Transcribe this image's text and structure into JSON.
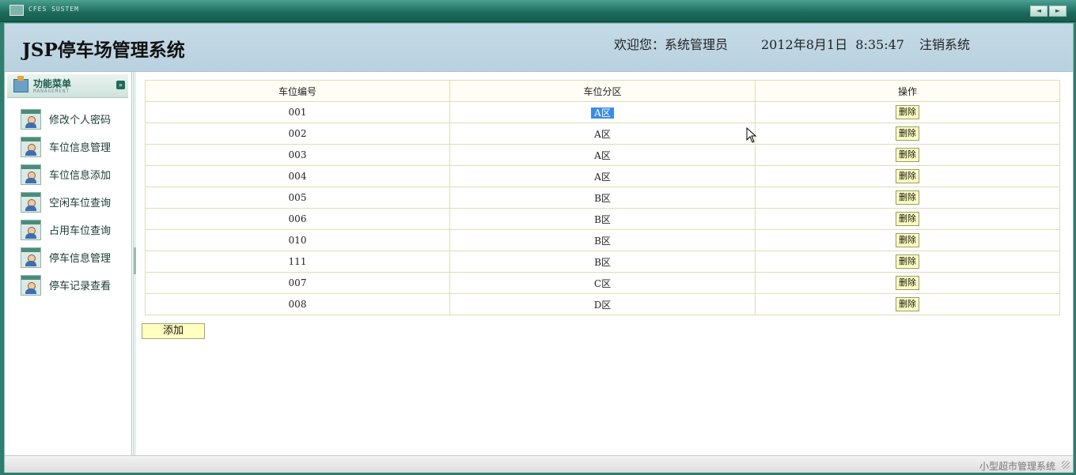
{
  "window": {
    "title": "CFES SUSTEM",
    "nav_prev": "◄",
    "nav_next": "►"
  },
  "header": {
    "app_title": "JSP停车场管理系统",
    "welcome": "欢迎您：系统管理员",
    "date": "2012年8月1日",
    "time": "8:35:47",
    "logout": "注销系统"
  },
  "sidebar": {
    "menu_title": "功能菜单",
    "menu_subtitle": "MANAGEMENT",
    "items": [
      {
        "label": "修改个人密码"
      },
      {
        "label": "车位信息管理"
      },
      {
        "label": "车位信息添加"
      },
      {
        "label": "空闲车位查询"
      },
      {
        "label": "占用车位查询"
      },
      {
        "label": "停车信息管理"
      },
      {
        "label": "停车记录查看"
      }
    ]
  },
  "table": {
    "headers": [
      "车位编号",
      "车位分区",
      "操作"
    ],
    "rows": [
      {
        "id": "001",
        "zone": "A区",
        "action": "删除"
      },
      {
        "id": "002",
        "zone": "A区",
        "action": "删除"
      },
      {
        "id": "003",
        "zone": "A区",
        "action": "删除"
      },
      {
        "id": "004",
        "zone": "A区",
        "action": "删除"
      },
      {
        "id": "005",
        "zone": "B区",
        "action": "删除"
      },
      {
        "id": "006",
        "zone": "B区",
        "action": "删除"
      },
      {
        "id": "010",
        "zone": "B区",
        "action": "删除"
      },
      {
        "id": "111",
        "zone": "B区",
        "action": "删除"
      },
      {
        "id": "007",
        "zone": "C区",
        "action": "删除"
      },
      {
        "id": "008",
        "zone": "D区",
        "action": "删除"
      }
    ]
  },
  "add_button": "添加",
  "footer": {
    "text": "小型超市管理系统"
  }
}
